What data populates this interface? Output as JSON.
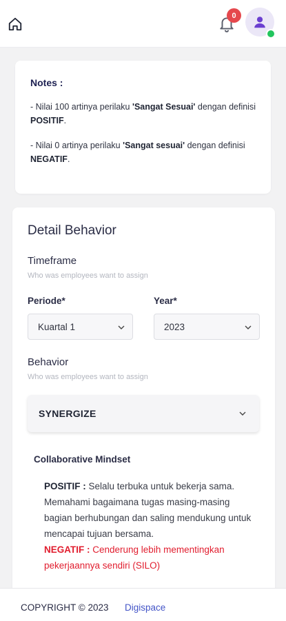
{
  "header": {
    "notification_count": "0"
  },
  "notes": {
    "title": "Notes :",
    "line1_prefix": "- Nilai 100 artinya perilaku ",
    "line1_bold": "'Sangat Sesuai'",
    "line1_mid": " dengan definisi ",
    "line1_strong": "POSITIF",
    "line1_end": ".",
    "line2_prefix": "- Nilai 0 artinya perilaku ",
    "line2_bold": "'Sangat sesuai'",
    "line2_mid": " dengan definisi ",
    "line2_strong": "NEGATIF",
    "line2_end": "."
  },
  "detail": {
    "title": "Detail Behavior",
    "timeframe_label": "Timeframe",
    "timeframe_hint": "Who was employees want to assign",
    "periode_label": "Periode*",
    "periode_value": "Kuartal 1",
    "year_label": "Year*",
    "year_value": "2023",
    "behavior_label": "Behavior",
    "behavior_hint": "Who was employees want to assign",
    "behavior_value": "SYNERGIZE",
    "subtitle": "Collaborative Mindset",
    "positif_label": "POSITIF :",
    "positif_text": " Selalu terbuka untuk bekerja sama. Memahami bagaimana tugas masing-masing bagian berhubungan dan saling mendukung untuk mencapai tujuan bersama.",
    "negatif_label": "NEGATIF :",
    "negatif_text": " Cenderung lebih mementingkan pekerjaannya sendiri (SILO)"
  },
  "footer": {
    "copyright": "COPYRIGHT © 2023",
    "brand": "Digispace"
  },
  "icons": {
    "home": "home-icon",
    "bell": "bell-icon",
    "avatar": "user-icon",
    "chevron": "chevron-down-icon"
  },
  "colors": {
    "badge": "#e5484d",
    "avatar_bg": "#ebe7f7",
    "avatar_icon": "#6b3fd0",
    "online": "#22c55e",
    "negatif": "#e11d2e",
    "brand_link": "#4455c7"
  }
}
